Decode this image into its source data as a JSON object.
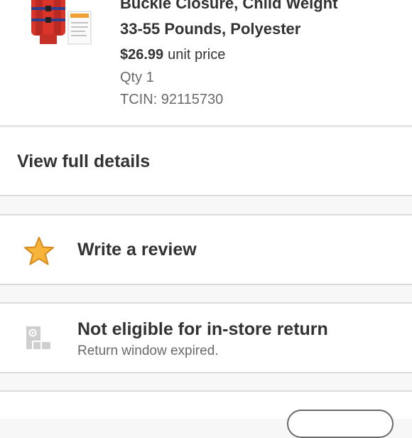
{
  "product": {
    "title_line1": "Buckle Closure, Child Weight",
    "title_line2": "33-55 Pounds, Polyester",
    "price": "$26.99",
    "price_unit": "unit price",
    "qty": "Qty 1",
    "tcin": "TCIN: 92115730"
  },
  "details": {
    "label": "View full details"
  },
  "review": {
    "label": "Write a review",
    "icon": "star-icon"
  },
  "returns": {
    "label": "Not eligible for in-store return",
    "sub": "Return window expired.",
    "icon": "store-return-icon"
  },
  "colors": {
    "star": "#f6b53a",
    "star_stroke": "#d98a1c",
    "text": "#333333",
    "muted": "#6a6a6a"
  }
}
